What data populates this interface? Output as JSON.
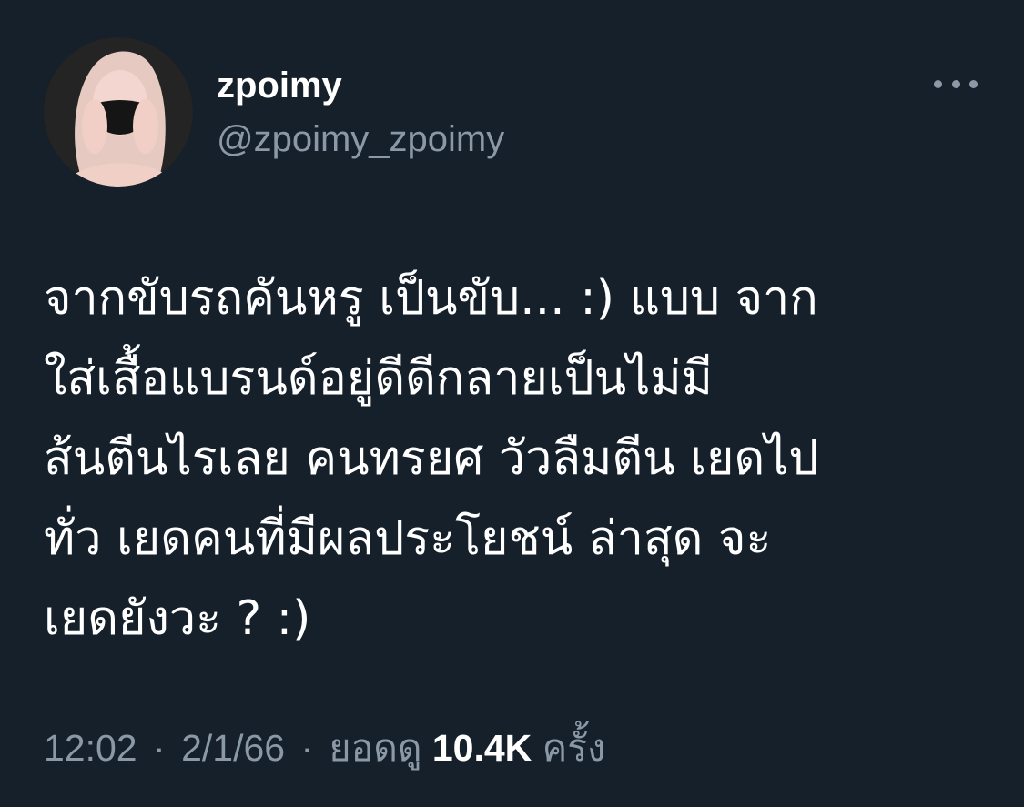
{
  "author": {
    "display_name": "zpoimy",
    "handle": "@zpoimy_zpoimy"
  },
  "tweet": {
    "lines": [
      "จากขับรถคันหรู เป็นขับ... :) แบบ จาก",
      " ใส่เสื้อแบรนด์อยู่ดีดีกลายเป็นไม่มี",
      "ส้นตีนไรเลย คนทรยศ วัวลืมตีน เยดไป",
      "ทั่ว เยดคนที่มีผลประโยชน์ ล่าสุด จะ",
      "เยดยังวะ ? :)"
    ]
  },
  "meta": {
    "time": "12:02",
    "separator": "·",
    "date": "2/1/66",
    "views_label": "ยอดดู",
    "views_count": "10.4K",
    "views_suffix": "ครั้ง"
  },
  "icons": {
    "more": "more-horizontal-icon"
  },
  "colors": {
    "background": "#15202b",
    "text_primary": "#ffffff",
    "text_secondary": "#8b98a5"
  }
}
